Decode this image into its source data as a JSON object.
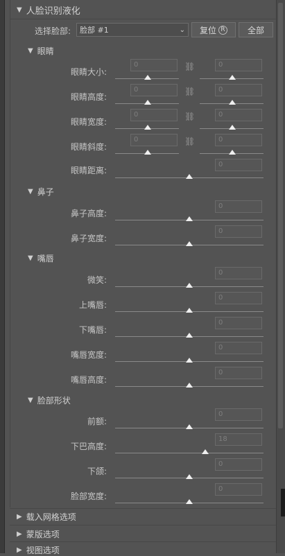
{
  "panel": {
    "title": "人脸识别液化",
    "select_face_label": "选择脸部:",
    "select_face_value": "脸部 #1",
    "reset_button": "复位",
    "reset_shortcut": "R",
    "all_button": "全部"
  },
  "groups": {
    "eyes": {
      "title": "眼睛",
      "rows": [
        {
          "label": "眼睛大小:",
          "left_value": "0",
          "right_value": "0"
        },
        {
          "label": "眼睛高度:",
          "left_value": "0",
          "right_value": "0"
        },
        {
          "label": "眼睛宽度:",
          "left_value": "0",
          "right_value": "0"
        },
        {
          "label": "眼睛斜度:",
          "left_value": "0",
          "right_value": "0"
        }
      ],
      "distance": {
        "label": "眼睛距离:",
        "value": "0"
      }
    },
    "nose": {
      "title": "鼻子",
      "rows": [
        {
          "label": "鼻子高度:",
          "value": "0"
        },
        {
          "label": "鼻子宽度:",
          "value": "0"
        }
      ]
    },
    "mouth": {
      "title": "嘴唇",
      "rows": [
        {
          "label": "微笑:",
          "value": "0"
        },
        {
          "label": "上嘴唇:",
          "value": "0"
        },
        {
          "label": "下嘴唇:",
          "value": "0"
        },
        {
          "label": "嘴唇宽度:",
          "value": "0"
        },
        {
          "label": "嘴唇高度:",
          "value": "0"
        }
      ]
    },
    "face_shape": {
      "title": "脸部形状",
      "rows": [
        {
          "label": "前额:",
          "value": "0"
        },
        {
          "label": "下巴高度:",
          "value": "18"
        },
        {
          "label": "下颌:",
          "value": "0"
        },
        {
          "label": "脸部宽度:",
          "value": "0"
        }
      ]
    }
  },
  "collapsed_sections": {
    "mesh": "载入网格选项",
    "mask": "蒙版选项",
    "view": "视图选项"
  },
  "icons": {
    "expand": "triangle-down-icon",
    "collapse": "triangle-right-icon",
    "link": "chain-link-icon",
    "dropdown": "chevron-down-icon"
  },
  "colors": {
    "panel_bg": "#535353",
    "text": "#c8c8c8",
    "slider_thumb": "#efefef"
  }
}
